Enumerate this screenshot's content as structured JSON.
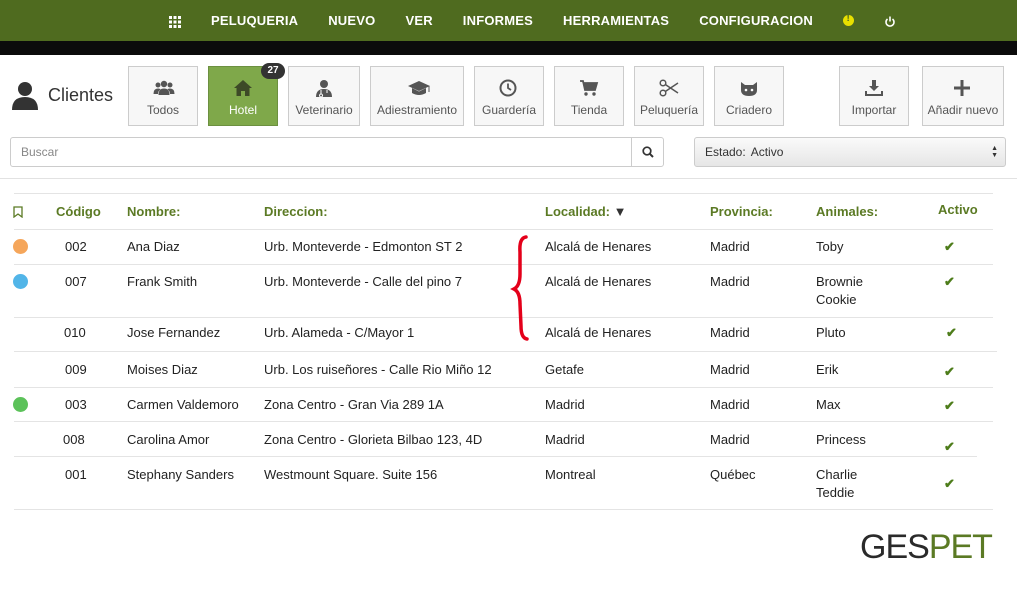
{
  "topnav": {
    "items": [
      "PELUQUERIA",
      "NUEVO",
      "VER",
      "INFORMES",
      "HERRAMIENTAS",
      "CONFIGURACION"
    ]
  },
  "header": {
    "title": "Clientes"
  },
  "tabs": [
    {
      "label": "Todos",
      "icon": "users-icon"
    },
    {
      "label": "Hotel",
      "icon": "home-icon",
      "badge": "27",
      "active": true
    },
    {
      "label": "Veterinario",
      "icon": "doctor-icon"
    },
    {
      "label": "Adiestramiento",
      "icon": "graduation-cap-icon"
    },
    {
      "label": "Guardería",
      "icon": "clock-icon"
    },
    {
      "label": "Tienda",
      "icon": "cart-icon"
    },
    {
      "label": "Peluquería",
      "icon": "scissors-icon"
    },
    {
      "label": "Criadero",
      "icon": "cat-icon"
    },
    {
      "label": "Importar",
      "icon": "download-icon"
    },
    {
      "label": "Añadir nuevo",
      "icon": "plus-icon"
    }
  ],
  "search": {
    "placeholder": "Buscar",
    "value": ""
  },
  "status": {
    "label": "Estado:",
    "value": "Activo"
  },
  "table": {
    "headers": {
      "codigo": "Código",
      "nombre": "Nombre:",
      "direccion": "Direccion:",
      "localidad": "Localidad:",
      "provincia": "Provincia:",
      "animales": "Animales:",
      "activo": "Activo"
    },
    "rows": [
      {
        "dot": "#f5a65b",
        "codigo": "002",
        "nombre": "Ana Diaz",
        "direccion": "Urb. Monteverde - Edmonton ST 2",
        "localidad": "Alcalá de Henares",
        "provincia": "Madrid",
        "animales": [
          "Toby"
        ]
      },
      {
        "dot": "#52b5e8",
        "codigo": "007",
        "nombre": "Frank Smith",
        "direccion": "Urb. Monteverde - Calle del pino 7",
        "localidad": "Alcalá de Henares",
        "provincia": "Madrid",
        "animales": [
          "Brownie",
          "Cookie"
        ]
      },
      {
        "dot": "",
        "codigo": "010",
        "nombre": "Jose Fernandez",
        "direccion": "Urb. Alameda - C/Mayor 1",
        "localidad": "Alcalá de Henares",
        "provincia": "Madrid",
        "animales": [
          "Pluto"
        ]
      },
      {
        "dot": "",
        "codigo": "009",
        "nombre": "Moises Diaz",
        "direccion": "Urb. Los ruiseñores - Calle Rio Miño 12",
        "localidad": "Getafe",
        "provincia": "Madrid",
        "animales": [
          "Erik"
        ]
      },
      {
        "dot": "#5cc25a",
        "codigo": "003",
        "nombre": "Carmen Valdemoro",
        "direccion": "Zona Centro - Gran Via 289 1A",
        "localidad": "Madrid",
        "provincia": "Madrid",
        "animales": [
          "Max"
        ]
      },
      {
        "dot": "",
        "codigo": "008",
        "nombre": "Carolina Amor",
        "direccion": "Zona Centro - Glorieta Bilbao 123, 4D",
        "localidad": "Madrid",
        "provincia": "Madrid",
        "animales": [
          "Princess"
        ]
      },
      {
        "dot": "",
        "codigo": "001",
        "nombre": "Stephany Sanders",
        "direccion": "Westmount Square. Suite 156",
        "localidad": "Montreal",
        "provincia": "Québec",
        "animales": [
          "Charlie",
          "Teddie"
        ]
      }
    ]
  },
  "logo": {
    "part1": "GES",
    "part2": "PET"
  },
  "colors": {
    "nav": "#4f6b1f",
    "accent": "#5b7a24",
    "active_tab": "#7fa84a"
  }
}
